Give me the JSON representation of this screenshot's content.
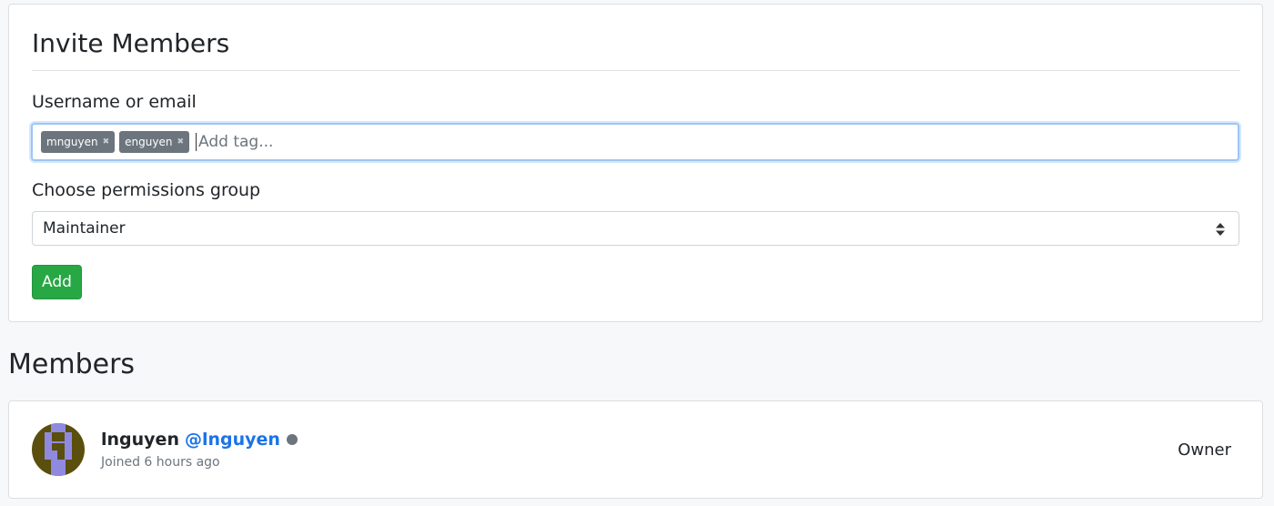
{
  "invite": {
    "title": "Invite Members",
    "username_label": "Username or email",
    "tags": [
      "mnguyen",
      "enguyen"
    ],
    "tag_remove_glyph": "✖",
    "tag_placeholder": "Add tag...",
    "permissions_label": "Choose permissions group",
    "permissions_selected": "Maintainer",
    "add_label": "Add"
  },
  "members": {
    "heading": "Members",
    "list": [
      {
        "name": "lnguyen",
        "handle": "@lnguyen",
        "joined": "Joined 6 hours ago",
        "role": "Owner"
      }
    ]
  },
  "colors": {
    "accent_green": "#28a745",
    "link_blue": "#1a73e8",
    "avatar_bg": "#5a4f0d",
    "avatar_fg": "#8f8ae0"
  }
}
